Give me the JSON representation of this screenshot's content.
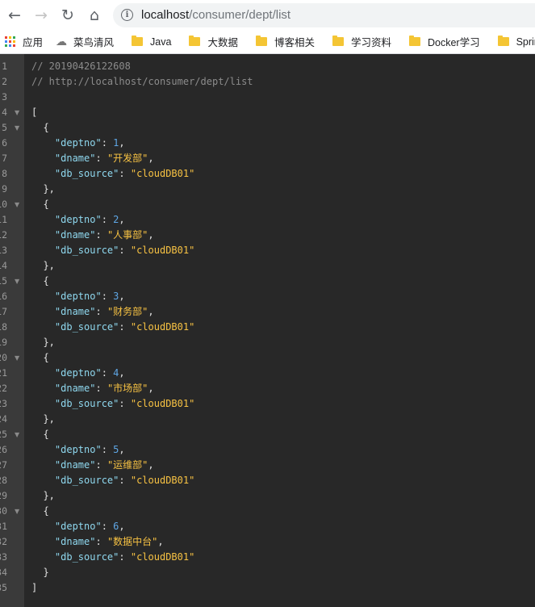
{
  "browser": {
    "url_host": "localhost",
    "url_path": "/consumer/dept/list",
    "back_icon": "arrow-left-icon",
    "forward_icon": "arrow-right-icon",
    "reload_icon": "reload-icon",
    "home_icon": "home-icon"
  },
  "bookmarks": {
    "apps_label": "应用",
    "items": [
      {
        "label": "菜鸟清风",
        "icon": "cloud-icon"
      },
      {
        "label": "Java",
        "icon": "folder-icon"
      },
      {
        "label": "大数据",
        "icon": "folder-icon"
      },
      {
        "label": "博客相关",
        "icon": "folder-icon"
      },
      {
        "label": "学习资料",
        "icon": "folder-icon"
      },
      {
        "label": "Docker学习",
        "icon": "folder-icon"
      },
      {
        "label": "SpringCloud",
        "icon": "folder-icon"
      }
    ]
  },
  "viewer": {
    "comment_timestamp": "// 20190426122608",
    "comment_url": "// http://localhost/consumer/dept/list",
    "keys": {
      "deptno": "\"deptno\"",
      "dname": "\"dname\"",
      "db_source": "\"db_source\""
    },
    "records": [
      {
        "deptno": "1",
        "dname": "\"开发部\"",
        "db_source": "\"cloudDB01\""
      },
      {
        "deptno": "2",
        "dname": "\"人事部\"",
        "db_source": "\"cloudDB01\""
      },
      {
        "deptno": "3",
        "dname": "\"财务部\"",
        "db_source": "\"cloudDB01\""
      },
      {
        "deptno": "4",
        "dname": "\"市场部\"",
        "db_source": "\"cloudDB01\""
      },
      {
        "deptno": "5",
        "dname": "\"运维部\"",
        "db_source": "\"cloudDB01\""
      },
      {
        "deptno": "6",
        "dname": "\"数据中台\"",
        "db_source": "\"cloudDB01\""
      }
    ]
  },
  "colors": {
    "background": "#282828",
    "gutter": "#3a3a3a",
    "key": "#8fd8ef",
    "number": "#5fa7e6",
    "string": "#f7c243",
    "comment": "#8c8c8c"
  }
}
